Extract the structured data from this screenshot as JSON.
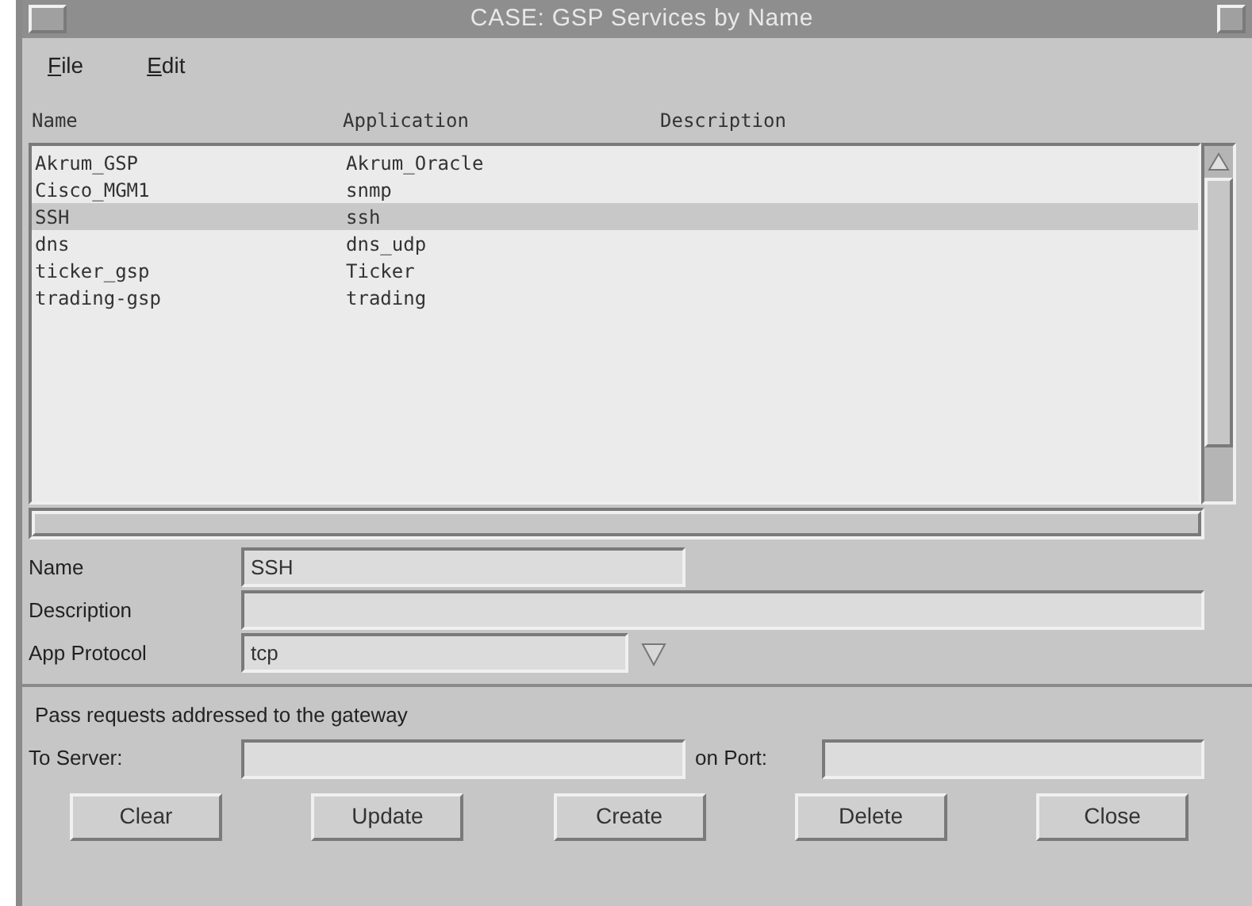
{
  "window": {
    "title": "CASE: GSP Services by Name"
  },
  "menu": [
    {
      "label": "File"
    },
    {
      "label": "Edit"
    }
  ],
  "table": {
    "columns": [
      "Name",
      "Application",
      "Description"
    ],
    "rows": [
      {
        "name": "Akrum_GSP",
        "application": "Akrum_Oracle",
        "selected": false
      },
      {
        "name": "Cisco_MGM1",
        "application": "snmp",
        "selected": false
      },
      {
        "name": "SSH",
        "application": "ssh",
        "selected": true
      },
      {
        "name": "dns",
        "application": "dns_udp",
        "selected": false
      },
      {
        "name": "ticker_gsp",
        "application": "Ticker",
        "selected": false
      },
      {
        "name": "trading-gsp",
        "application": "trading",
        "selected": false
      }
    ]
  },
  "form": {
    "name": {
      "label": "Name",
      "value": "SSH"
    },
    "description": {
      "label": "Description"
    },
    "app_protocol": {
      "label": "App Protocol",
      "value": "tcp"
    }
  },
  "gateway": {
    "heading": "Pass requests addressed to the gateway",
    "server_label": "To Server:",
    "port_label": "on Port:"
  },
  "buttons": [
    "Clear",
    "Update",
    "Create",
    "Delete",
    "Close"
  ]
}
